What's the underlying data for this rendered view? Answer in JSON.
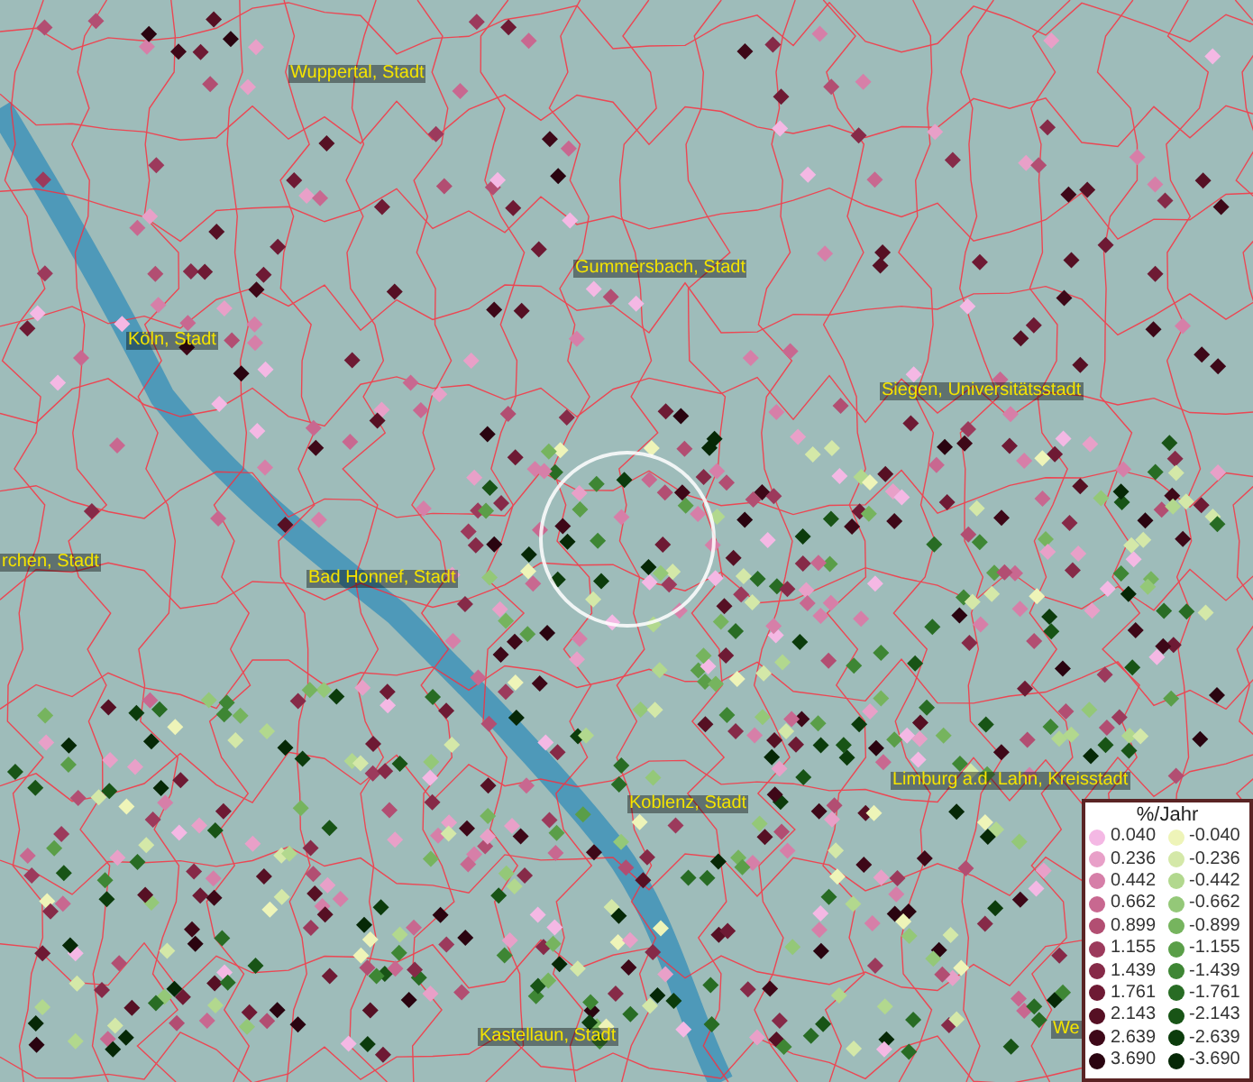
{
  "map": {
    "labels": [
      {
        "text": "Wuppertal, Stadt"
      },
      {
        "text": "Gummersbach, Stadt"
      },
      {
        "text": "Köln, Stadt"
      },
      {
        "text": "Siegen, Universitätsstadt"
      },
      {
        "text": "rchen, Stadt"
      },
      {
        "text": "Bad Honnef, Stadt"
      },
      {
        "text": "Koblenz, Stadt"
      },
      {
        "text": "Limburg a.d. Lahn, Kreisstadt"
      },
      {
        "text": "Kastellaun, Stadt"
      },
      {
        "text": "We"
      }
    ]
  },
  "legend": {
    "title": "%/Jahr",
    "positive": [
      {
        "value": "0.040",
        "color": "#f4b8e4"
      },
      {
        "value": "0.236",
        "color": "#e8a0c8"
      },
      {
        "value": "0.442",
        "color": "#d67fa8"
      },
      {
        "value": "0.662",
        "color": "#c86890"
      },
      {
        "value": "0.899",
        "color": "#b24e72"
      },
      {
        "value": "1.155",
        "color": "#9c3a5c"
      },
      {
        "value": "1.439",
        "color": "#862a48"
      },
      {
        "value": "1.761",
        "color": "#6e1a34"
      },
      {
        "value": "2.143",
        "color": "#561024"
      },
      {
        "value": "2.639",
        "color": "#3e0818"
      },
      {
        "value": "3.690",
        "color": "#2a0410"
      }
    ],
    "negative": [
      {
        "value": "-0.040",
        "color": "#eef4b8"
      },
      {
        "value": "-0.236",
        "color": "#d4e8a8"
      },
      {
        "value": "-0.442",
        "color": "#b2d88e"
      },
      {
        "value": "-0.662",
        "color": "#94c878"
      },
      {
        "value": "-0.899",
        "color": "#76b45e"
      },
      {
        "value": "-1.155",
        "color": "#5a9e48"
      },
      {
        "value": "-1.439",
        "color": "#3e8634"
      },
      {
        "value": "-1.761",
        "color": "#286c24"
      },
      {
        "value": "-2.143",
        "color": "#185416"
      },
      {
        "value": "-2.639",
        "color": "#0c3c0c"
      },
      {
        "value": "-3.690",
        "color": "#062806"
      }
    ]
  }
}
